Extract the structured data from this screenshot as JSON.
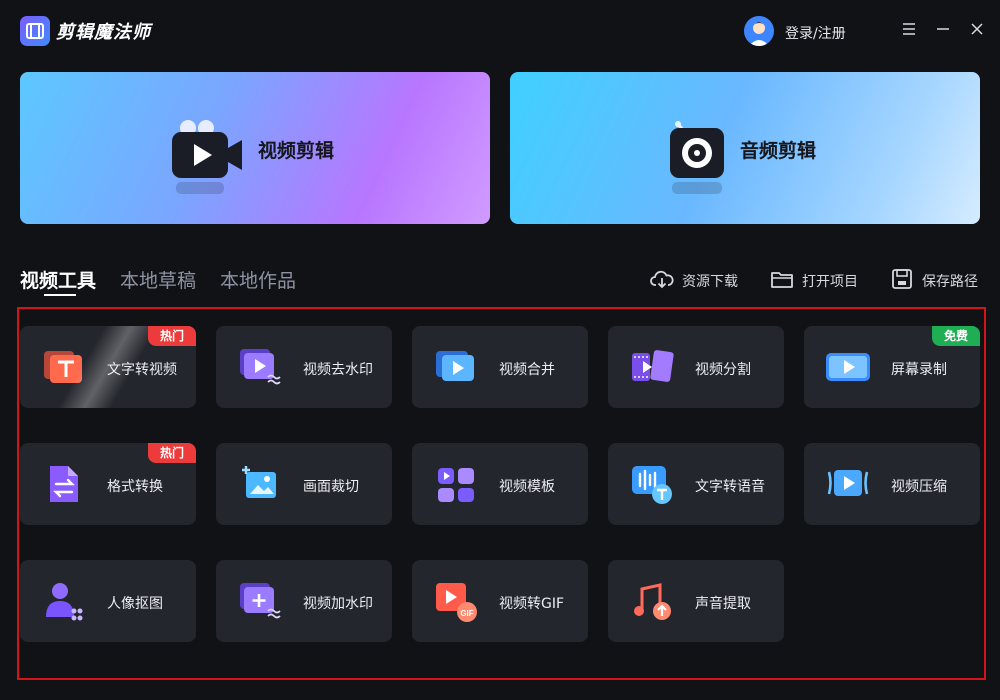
{
  "app": {
    "title": "剪辑魔法师",
    "login_label": "登录/注册"
  },
  "colors": {
    "background": "#111216",
    "card": "#24262d",
    "hot_badge": "#ec3b3b",
    "free_badge": "#1fae54",
    "highlight_frame": "#d3141b"
  },
  "hero": {
    "video": {
      "label": "视频剪辑",
      "icon": "video-camera-icon"
    },
    "audio": {
      "label": "音频剪辑",
      "icon": "audio-disc-icon"
    }
  },
  "tabs": [
    {
      "label": "视频工具",
      "active": true
    },
    {
      "label": "本地草稿",
      "active": false
    },
    {
      "label": "本地作品",
      "active": false
    }
  ],
  "actions": [
    {
      "label": "资源下载",
      "icon": "cloud-download-icon"
    },
    {
      "label": "打开项目",
      "icon": "folder-icon"
    },
    {
      "label": "保存路径",
      "icon": "save-icon"
    }
  ],
  "tools": [
    {
      "label": "文字转视频",
      "badge": "热门",
      "icon": "text-to-video-icon"
    },
    {
      "label": "视频去水印",
      "badge": "",
      "icon": "remove-watermark-icon"
    },
    {
      "label": "视频合并",
      "badge": "",
      "icon": "merge-video-icon"
    },
    {
      "label": "视频分割",
      "badge": "",
      "icon": "split-video-icon"
    },
    {
      "label": "屏幕录制",
      "badge": "免费",
      "icon": "screen-record-icon"
    },
    {
      "label": "格式转换",
      "badge": "热门",
      "icon": "format-convert-icon"
    },
    {
      "label": "画面裁切",
      "badge": "",
      "icon": "crop-icon"
    },
    {
      "label": "视频模板",
      "badge": "",
      "icon": "template-icon"
    },
    {
      "label": "文字转语音",
      "badge": "",
      "icon": "text-to-speech-icon"
    },
    {
      "label": "视频压缩",
      "badge": "",
      "icon": "compress-video-icon"
    },
    {
      "label": "人像抠图",
      "badge": "",
      "icon": "portrait-cutout-icon"
    },
    {
      "label": "视频加水印",
      "badge": "",
      "icon": "add-watermark-icon"
    },
    {
      "label": "视频转GIF",
      "badge": "",
      "icon": "video-to-gif-icon"
    },
    {
      "label": "声音提取",
      "badge": "",
      "icon": "audio-extract-icon"
    }
  ]
}
